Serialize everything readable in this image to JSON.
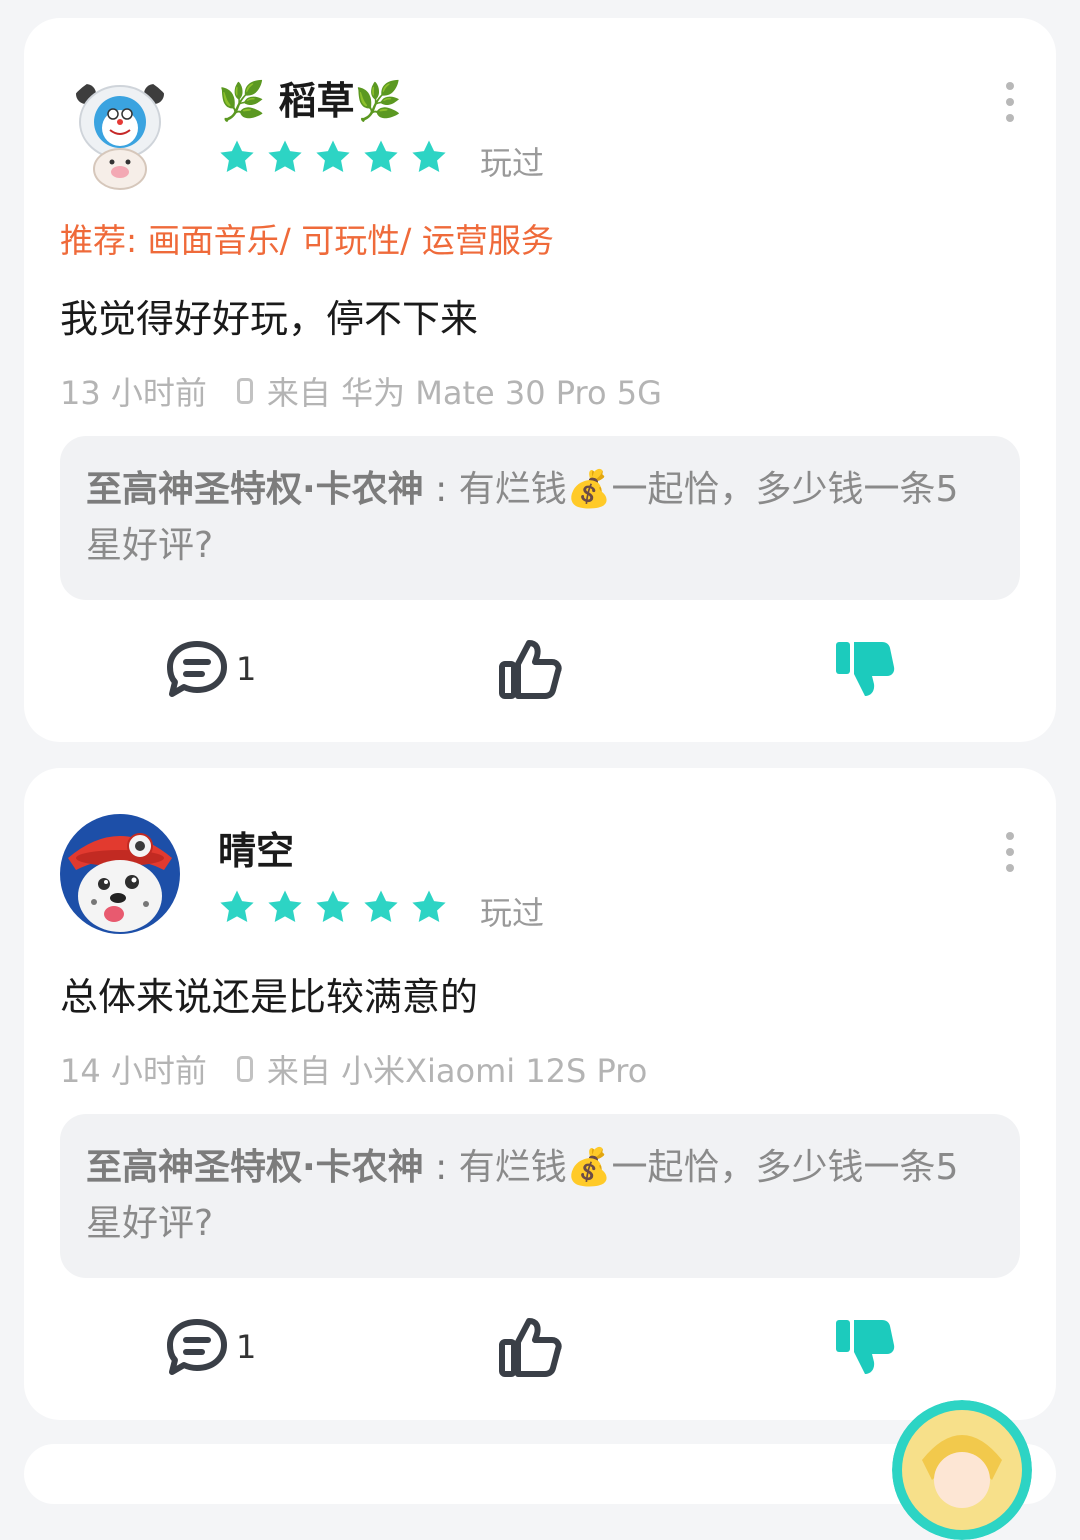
{
  "colors": {
    "star": "#2dd4c4",
    "recommend": "#ef6a3a",
    "dislike_active": "#1ccbbd",
    "icon_dark": "#3a3f47"
  },
  "reviews": [
    {
      "username": "🌿 稻草🌿",
      "rating": 5,
      "played_label": "玩过",
      "recommend": "推荐: 画面音乐/ 可玩性/ 运营服务",
      "text": "我觉得好好玩，停不下来",
      "time": "13 小时前",
      "device": "来自 华为 Mate 30 Pro 5G",
      "reply": {
        "author": "至高神圣特权·卡农神",
        "separator": " : ",
        "text": "有烂钱💰一起恰，多少钱一条5星好评?"
      },
      "comment_count": "1",
      "icons": [
        "more-vertical-icon",
        "phone-icon",
        "comment-icon",
        "thumbs-up-icon",
        "thumbs-down-icon"
      ]
    },
    {
      "username": "晴空",
      "rating": 5,
      "played_label": "玩过",
      "text": "总体来说还是比较满意的",
      "time": "14 小时前",
      "device": "来自 小米Xiaomi 12S Pro",
      "reply": {
        "author": "至高神圣特权·卡农神",
        "separator": " : ",
        "text": "有烂钱💰一起恰，多少钱一条5星好评?"
      },
      "comment_count": "1",
      "icons": [
        "more-vertical-icon",
        "phone-icon",
        "comment-icon",
        "thumbs-up-icon",
        "thumbs-down-icon"
      ]
    }
  ]
}
